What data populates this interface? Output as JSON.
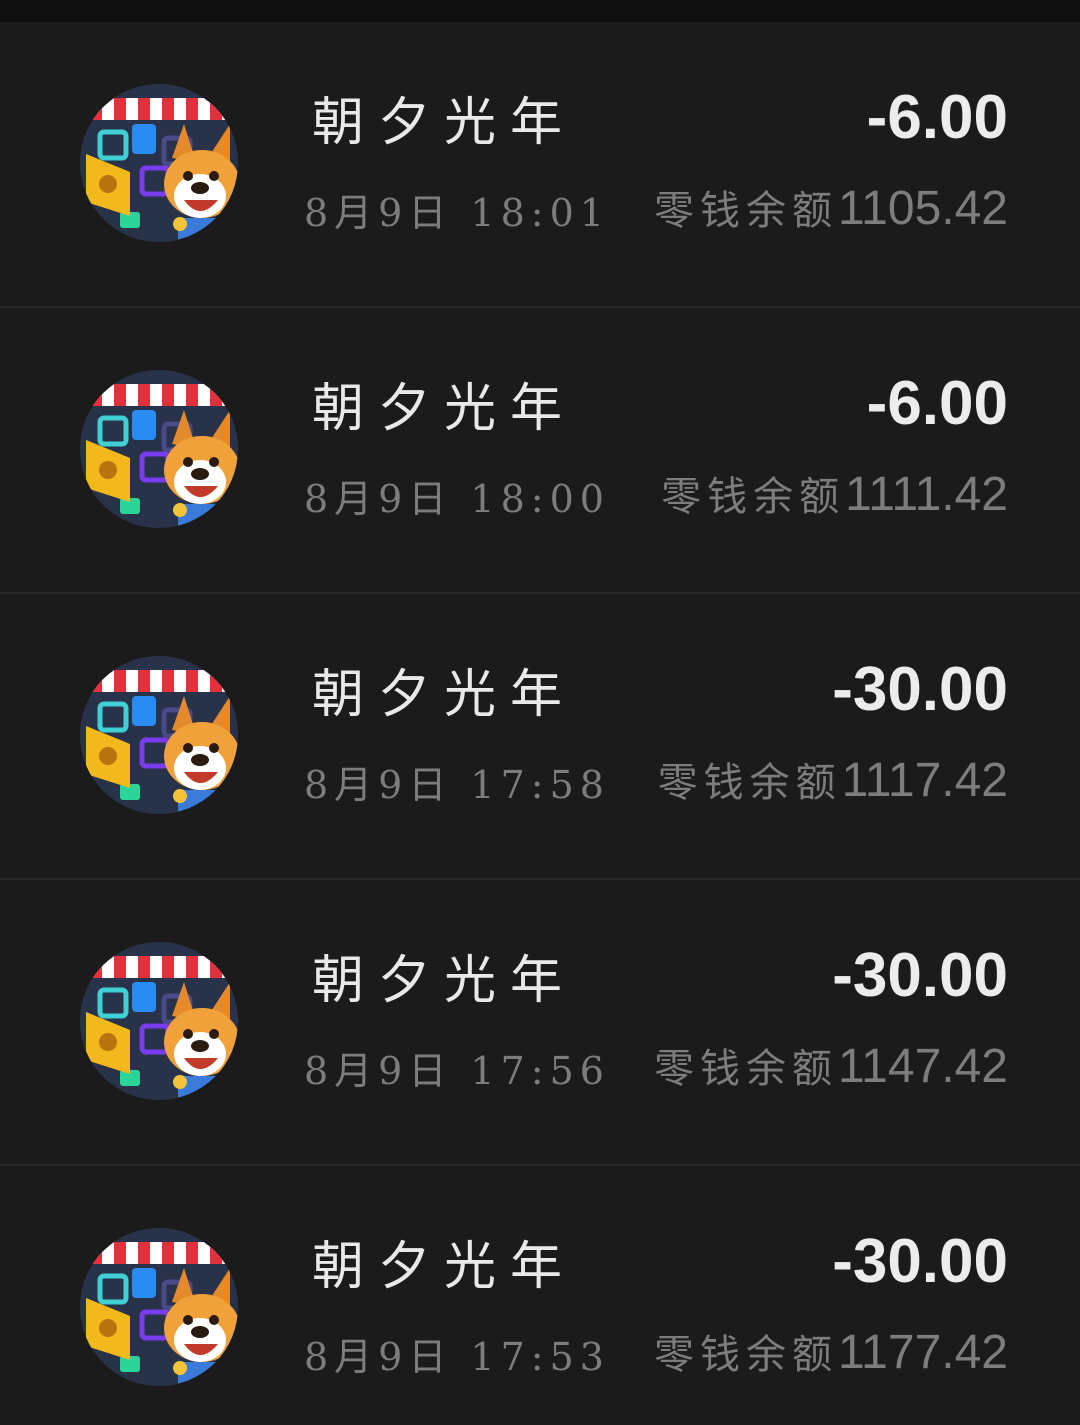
{
  "transactions": [
    {
      "merchant": "朝夕光年",
      "amount": "-6.00",
      "time": "8月9日 18:01",
      "balance_label": "零钱余额",
      "balance_value": "1105.42"
    },
    {
      "merchant": "朝夕光年",
      "amount": "-6.00",
      "time": "8月9日 18:00",
      "balance_label": "零钱余额",
      "balance_value": "1111.42"
    },
    {
      "merchant": "朝夕光年",
      "amount": "-30.00",
      "time": "8月9日 17:58",
      "balance_label": "零钱余额",
      "balance_value": "1117.42"
    },
    {
      "merchant": "朝夕光年",
      "amount": "-30.00",
      "time": "8月9日 17:56",
      "balance_label": "零钱余额",
      "balance_value": "1147.42"
    },
    {
      "merchant": "朝夕光年",
      "amount": "-30.00",
      "time": "8月9日 17:53",
      "balance_label": "零钱余额",
      "balance_value": "1177.42"
    }
  ],
  "avatar_icon": "game-app-dog-icon",
  "colors": {
    "background": "#1b1b1b",
    "divider": "#262626",
    "primary_text": "#ececec",
    "secondary_text": "#7d7d7d"
  }
}
